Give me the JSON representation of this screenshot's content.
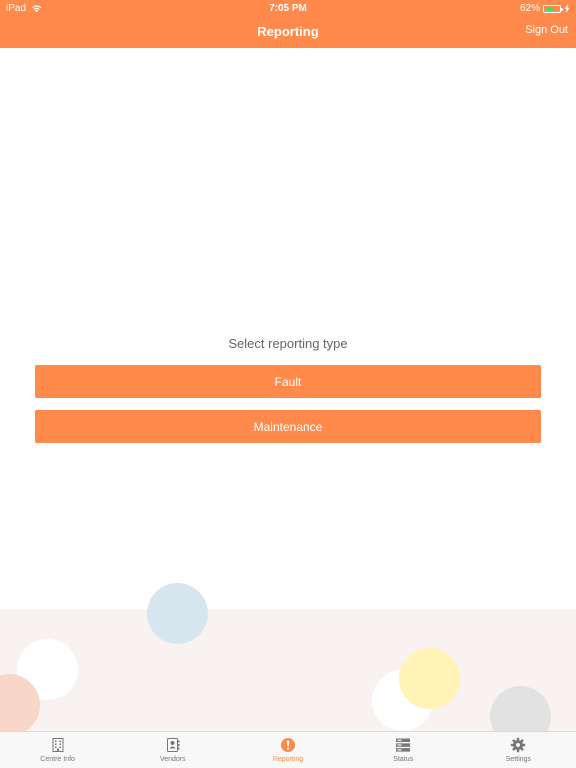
{
  "status_bar": {
    "device": "iPad",
    "time": "7:05 PM",
    "battery_percent": "62%",
    "battery_level": 0.62
  },
  "nav": {
    "title": "Reporting",
    "sign_out_label": "Sign Out"
  },
  "main": {
    "prompt": "Select reporting type",
    "options": [
      "Fault",
      "Maintenance"
    ]
  },
  "tabbar": {
    "tabs": [
      {
        "label": "Centre Info",
        "icon": "building-icon",
        "active": false
      },
      {
        "label": "Vendors",
        "icon": "contact-book-icon",
        "active": false
      },
      {
        "label": "Reporting",
        "icon": "alert-circle-icon",
        "active": true
      },
      {
        "label": "Status",
        "icon": "server-stack-icon",
        "active": false
      },
      {
        "label": "Settings",
        "icon": "gear-icon",
        "active": false
      }
    ]
  },
  "colors": {
    "accent": "#ff8a4c",
    "battery": "#4cd964",
    "tab_inactive": "#777777",
    "decor_background": "#f8f3f0"
  }
}
